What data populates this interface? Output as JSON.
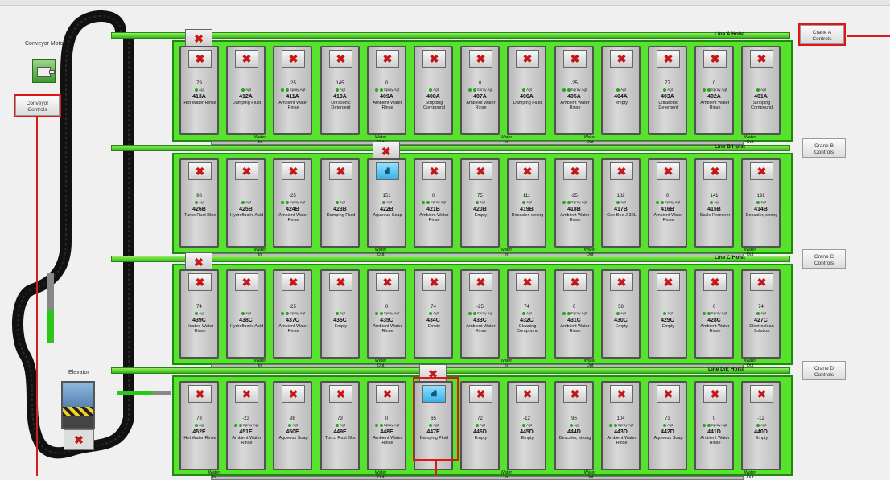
{
  "conveyor": {
    "motor_label": "Conveyor Motor",
    "controls_label": "Conveyor\nControls",
    "elevator_label": "Elevator"
  },
  "marks": {
    "crane": "✖",
    "basket": "⛘"
  },
  "lines": [
    {
      "id": "A",
      "hoist": "Line A Hoist",
      "controls": "Crane A\nControls",
      "water": [
        {
          "label": "Water\nIn"
        },
        {
          "label": "Water\nOut"
        },
        {
          "label": "Water\nIn"
        },
        {
          "label": "Water\nOut"
        }
      ],
      "tanks": [
        {
          "name": "413A",
          "value": "79",
          "lights": "Agt",
          "desc": "Hot Water Rinse"
        },
        {
          "name": "412A",
          "value": "",
          "lights": "Agt",
          "desc": "Damping Fluid"
        },
        {
          "name": "411A",
          "value": "-25",
          "lights": "Spray Agt",
          "desc": "Ambient Water Rinse"
        },
        {
          "name": "410A",
          "value": "145",
          "lights": "Agt",
          "desc": "Ultrasonic Detergent"
        },
        {
          "name": "409A",
          "value": "0",
          "lights": "Spray Agt",
          "desc": "Ambient Water Rinse"
        },
        {
          "name": "408A",
          "value": "",
          "lights": "Agt",
          "desc": "Stripping Compound"
        },
        {
          "name": "407A",
          "value": "0",
          "lights": "Spray Agt",
          "desc": "Ambient Water Rinse"
        },
        {
          "name": "406A",
          "value": "",
          "lights": "Agt",
          "desc": "Damping Fluid"
        },
        {
          "name": "405A",
          "value": "-25",
          "lights": "Spray Agt",
          "desc": "Ambient Water Rinse"
        },
        {
          "name": "404A",
          "value": "",
          "lights": "Agt",
          "desc": "empty"
        },
        {
          "name": "403A",
          "value": "77",
          "lights": "Agt",
          "desc": "Ultrasonic Detergent"
        },
        {
          "name": "402A",
          "value": "0",
          "lights": "Spray Agt",
          "desc": "Ambient Water Rinse"
        },
        {
          "name": "401A",
          "value": "",
          "lights": "Agt",
          "desc": "Stripping Compound"
        }
      ]
    },
    {
      "id": "B",
      "hoist": "Line B Hoist",
      "controls": "Crane B\nControls",
      "water": [
        {
          "label": "Water\nIn"
        },
        {
          "label": "Water\nOut"
        },
        {
          "label": "Water\nIn"
        },
        {
          "label": "Water\nOut"
        }
      ],
      "tanks": [
        {
          "name": "426B",
          "value": "98",
          "lights": "Agt",
          "desc": "Turco Rust Bloc"
        },
        {
          "name": "425B",
          "value": "",
          "lights": "Agt",
          "desc": "Hydrofluoric Acid"
        },
        {
          "name": "424B",
          "value": "-25",
          "lights": "Spray Agt",
          "desc": "Ambient Water Rinse"
        },
        {
          "name": "423B",
          "value": "",
          "lights": "Agt",
          "desc": "Damping Fluid"
        },
        {
          "name": "422B",
          "value": "151",
          "lights": "Agt",
          "desc": "Aqueous Soap"
        },
        {
          "name": "421B",
          "value": "0",
          "lights": "Spray Agt",
          "desc": "Ambient Water Rinse"
        },
        {
          "name": "420B",
          "value": "75",
          "lights": "Agt",
          "desc": "Empty"
        },
        {
          "name": "419B",
          "value": "111",
          "lights": "Agt",
          "desc": "Descaler, strong"
        },
        {
          "name": "418B",
          "value": "-25",
          "lights": "Spray Agt",
          "desc": "Ambient Water Rinse"
        },
        {
          "name": "417B",
          "value": "182",
          "lights": "Agt",
          "desc": "Cee Bee J-30L"
        },
        {
          "name": "416B",
          "value": "0",
          "lights": "Spray Agt",
          "desc": "Ambient Water Rinse"
        },
        {
          "name": "415B",
          "value": "141",
          "lights": "Agt",
          "desc": "Scale Remover"
        },
        {
          "name": "414B",
          "value": "191",
          "lights": "Agt",
          "desc": "Descaler, strong"
        }
      ]
    },
    {
      "id": "C",
      "hoist": "Line C Hoist",
      "controls": "Crane C\nControls",
      "water": [
        {
          "label": "Water\nIn"
        },
        {
          "label": "Water\nOut"
        },
        {
          "label": "Water\nIn"
        },
        {
          "label": "Water\nOut"
        }
      ],
      "tanks": [
        {
          "name": "439C",
          "value": "74",
          "lights": "Agt",
          "desc": "Heated Water Rinse"
        },
        {
          "name": "438C",
          "value": "",
          "lights": "Agt",
          "desc": "Hydrofluoric Acid"
        },
        {
          "name": "437C",
          "value": "-25",
          "lights": "Spray Agt",
          "desc": "Ambient Water Rinse"
        },
        {
          "name": "436C",
          "value": "",
          "lights": "Agt",
          "desc": "Empty"
        },
        {
          "name": "435C",
          "value": "0",
          "lights": "Spray Agt",
          "desc": "Ambient Water Rinse"
        },
        {
          "name": "434C",
          "value": "74",
          "lights": "Agt",
          "desc": "Empty"
        },
        {
          "name": "433C",
          "value": "-25",
          "lights": "Spray Agt",
          "desc": "Ambient Water Rinse"
        },
        {
          "name": "432C",
          "value": "74",
          "lights": "Agt",
          "desc": "Cleaning Compound"
        },
        {
          "name": "431C",
          "value": "0",
          "lights": "Spray Agt",
          "desc": "Ambient Water Rinse"
        },
        {
          "name": "430C",
          "value": "58",
          "lights": "Agt",
          "desc": "Empty"
        },
        {
          "name": "429C",
          "value": "",
          "lights": "Agt",
          "desc": "Empty"
        },
        {
          "name": "428C",
          "value": "0",
          "lights": "Spray Agt",
          "desc": "Ambient Water Rinse"
        },
        {
          "name": "427C",
          "value": "74",
          "lights": "Agt",
          "desc": "Electroclean Solution"
        }
      ]
    },
    {
      "id": "D",
      "hoist": "Line D/E Hoist",
      "controls": "Crane D\nControls",
      "water": [
        {
          "label": "Water\nIn"
        },
        {
          "label": "Water\nOut"
        },
        {
          "label": "Water\nIn"
        },
        {
          "label": "Water\nOut"
        }
      ],
      "tanks": [
        {
          "name": "452E",
          "value": "73",
          "lights": "Agt",
          "desc": "Hot Water Rinse"
        },
        {
          "name": "451E",
          "value": "-23",
          "lights": "Spray Agt",
          "desc": "Ambient Water Rinse"
        },
        {
          "name": "450E",
          "value": "98",
          "lights": "Agt",
          "desc": "Aqueous Soap"
        },
        {
          "name": "449E",
          "value": "73",
          "lights": "Agt",
          "desc": "Turco Rust Bloc"
        },
        {
          "name": "448E",
          "value": "0",
          "lights": "Spray Agt",
          "desc": "Ambient Water Rinse"
        },
        {
          "name": "447E",
          "value": "65",
          "lights": "Agt",
          "desc": "Damping Fluid"
        },
        {
          "name": "446D",
          "value": "72",
          "lights": "Agt",
          "desc": "Empty"
        },
        {
          "name": "445D",
          "value": "-12",
          "lights": "Agt",
          "desc": "Empty"
        },
        {
          "name": "444D",
          "value": "96",
          "lights": "Agt",
          "desc": "Descaler, strong"
        },
        {
          "name": "443D",
          "value": "104",
          "lights": "Spray Agt",
          "desc": "Ambient Water Rinse"
        },
        {
          "name": "442D",
          "value": "73",
          "lights": "Agt",
          "desc": "Aqueous Soap"
        },
        {
          "name": "441D",
          "value": "0",
          "lights": "Spray Agt",
          "desc": "Ambient Water Rinse"
        },
        {
          "name": "440D",
          "value": "-12",
          "lights": "Agt",
          "desc": "Empty"
        }
      ]
    }
  ]
}
